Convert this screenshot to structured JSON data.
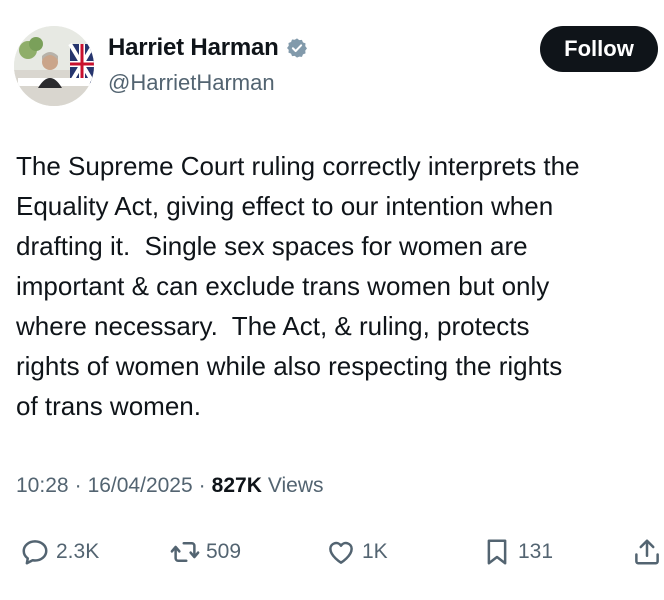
{
  "author": {
    "display_name": "Harriet Harman",
    "handle": "@HarrietHarman",
    "verified": true,
    "avatar_icon": "profile-photo"
  },
  "follow_button": {
    "label": "Follow"
  },
  "tweet": {
    "text": "The Supreme Court ruling correctly interprets the\nEquality Act, giving effect to our intention when\ndrafting it.  Single sex spaces for women are\nimportant & can exclude trans women but only\nwhere necessary.  The Act, & ruling, protects\nrights of women while also respecting the rights\nof trans women."
  },
  "meta": {
    "time": "10:28",
    "date": "16/04/2025",
    "separator": "·",
    "views_count": "827K",
    "views_label": "Views"
  },
  "actions": {
    "reply": {
      "count": "2.3K",
      "icon": "reply-icon"
    },
    "repost": {
      "count": "509",
      "icon": "repost-icon"
    },
    "like": {
      "count": "1K",
      "icon": "heart-icon"
    },
    "bookmark": {
      "count": "131",
      "icon": "bookmark-icon"
    },
    "share": {
      "icon": "share-icon"
    }
  },
  "colors": {
    "text": "#0f1419",
    "secondary": "#536471",
    "verified": "#829aab",
    "button_bg": "#0f1419"
  }
}
